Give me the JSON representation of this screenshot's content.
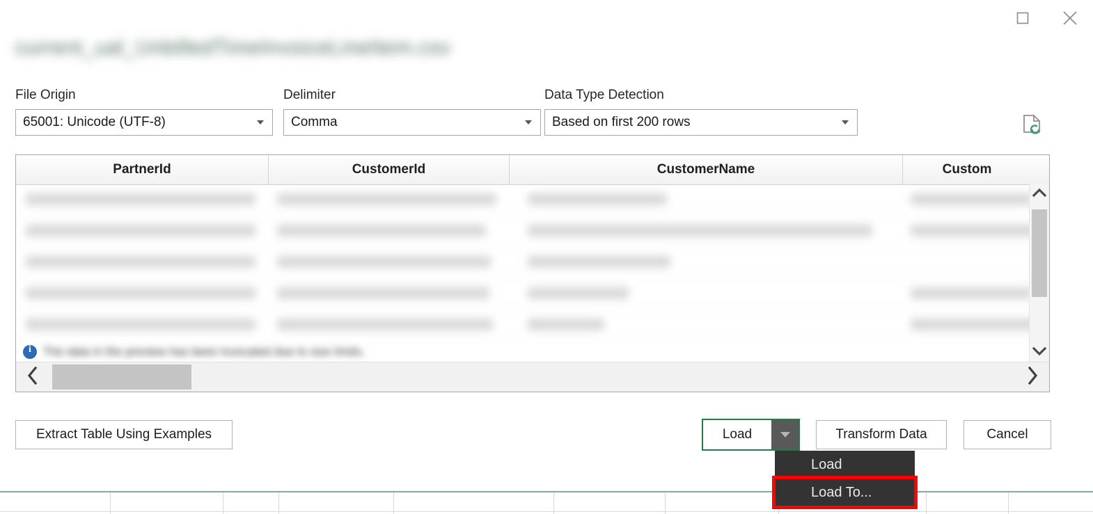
{
  "window": {
    "restore_label": "Restore",
    "close_label": "Close"
  },
  "dialog": {
    "title": "current_ual_UnbilledTimeInvoiceLineItem.csv",
    "title_redacted": true
  },
  "options": [
    {
      "label": "File Origin",
      "value": "65001: Unicode (UTF-8)",
      "name": "file-origin"
    },
    {
      "label": "Delimiter",
      "value": "Comma",
      "name": "delimiter"
    },
    {
      "label": "Data Type Detection",
      "value": "Based on first 200 rows",
      "name": "data-type-detection"
    }
  ],
  "refresh": {
    "icon": "refresh-file-icon",
    "tooltip": "Refresh preview"
  },
  "preview": {
    "columns": [
      {
        "label": "PartnerId"
      },
      {
        "label": "CustomerId"
      },
      {
        "label": "CustomerName"
      },
      {
        "label": "Custom"
      }
    ],
    "row_count_visible": 5,
    "rows_redacted": true,
    "note": "The data in the preview has been truncated due to size limits.",
    "note_icon": "info-icon",
    "scroll_up_icon": "chevron-up-icon",
    "scroll_down_icon": "chevron-down-icon",
    "scroll_left_icon": "chevron-left-icon",
    "scroll_right_icon": "chevron-right-icon"
  },
  "footer": {
    "extract_label": "Extract Table Using Examples",
    "load_label": "Load",
    "load_dropdown_icon": "caret-down-icon",
    "transform_label": "Transform Data",
    "cancel_label": "Cancel"
  },
  "menu": {
    "items": [
      {
        "label": "Load",
        "highlighted": false
      },
      {
        "label": "Load To...",
        "highlighted": true
      }
    ]
  },
  "colors": {
    "accent_green": "#1f7a45",
    "menu_bg": "#333333",
    "highlight_red": "#ff0000",
    "grid_line": "#d9d9d9",
    "excel_top_rule": "#7fae8f"
  }
}
